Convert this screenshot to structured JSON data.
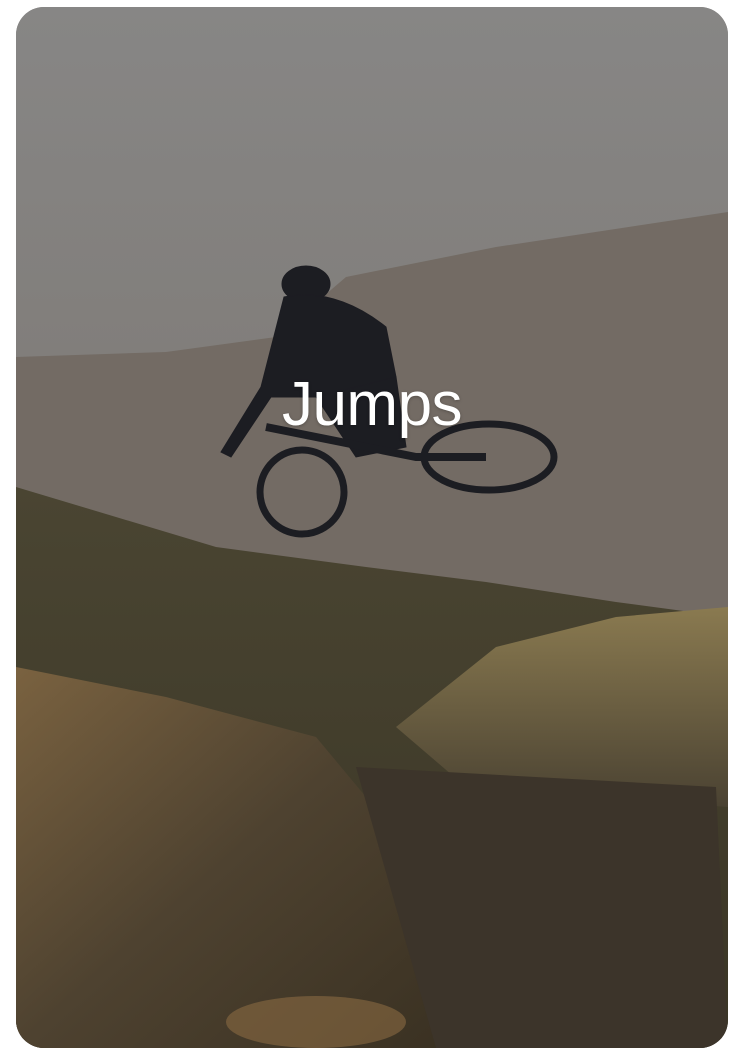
{
  "card": {
    "title": "Jumps",
    "image_icon": "mountain-bike-jump-photo"
  }
}
